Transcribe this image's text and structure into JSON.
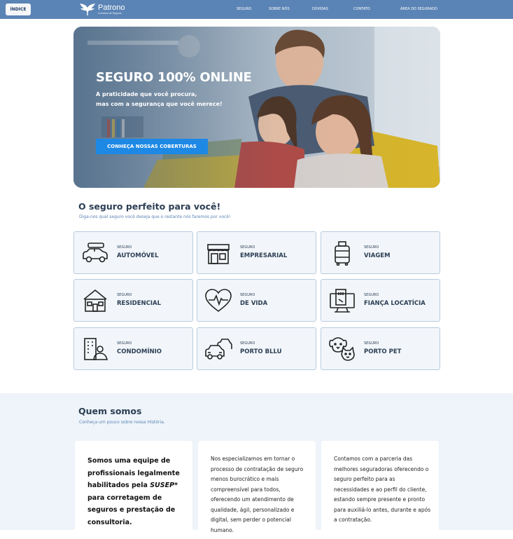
{
  "header": {
    "index_label": "ÍNDICE",
    "logo_name": "Patrono",
    "logo_tagline": "Corretora de Seguros",
    "nav": [
      "SEGURO",
      "SOBRE NÓS",
      "DÚVIDAS",
      "CONTATO",
      "ÁREA DO SEGURADO"
    ]
  },
  "hero": {
    "title": "SEGURO 100% ONLINE",
    "subtitle_line1": "A praticidade que você procura,",
    "subtitle_line2": "mas com a segurança que você merece!",
    "cta": "CONHEÇA NOSSAS COBERTURAS"
  },
  "products": {
    "title": "O seguro perfeito para você!",
    "subtitle": "Diga-nos qual seguro você deseja que o restante nós faremos por você!",
    "prefix": "SEGURO",
    "items": [
      {
        "name": "AUTOMÓVEL",
        "icon": "car-icon"
      },
      {
        "name": "EMPRESARIAL",
        "icon": "store-icon"
      },
      {
        "name": "VIAGEM",
        "icon": "luggage-icon"
      },
      {
        "name": "RESIDENCIAL",
        "icon": "house-icon"
      },
      {
        "name": "DE VIDA",
        "icon": "heart-pulse-icon"
      },
      {
        "name": "FIANÇA LOCATÍCIA",
        "icon": "rental-sign-icon"
      },
      {
        "name": "CONDOMÍNIO",
        "icon": "building-person-icon"
      },
      {
        "name": "PORTO BLLU",
        "icon": "cars-icon"
      },
      {
        "name": "PORTO PET",
        "icon": "pets-icon"
      }
    ]
  },
  "about": {
    "title": "Quem somos",
    "subtitle": "Conheça um pouco sobre nossa História.",
    "card1_a": "Somos uma equipe de profissionais legalmente habilitados pela ",
    "card1_brand": "SUSEP",
    "card1_b": "* para corretagem de seguros e prestação de consultoria.",
    "card2": "Nos especializamos em tornar o processo de contratação de seguro menos burocrático e mais compreensível para todos, oferecendo um atendimento de qualidade, ágil, personalizado e digital, sem perder o potencial humano.",
    "card3": "Contamos com a parceria das melhores seguradoras oferecendo o seguro perfeito para as necessidades e ao perfil do cliente, estando sempre presente e pronto para auxiliá-lo antes, durante e após a contratação."
  },
  "colors": {
    "header_bg": "#5b84b6",
    "cta_bg": "#1e88e5",
    "card_bg": "#f2f6fa",
    "card_border": "#b8cbe0",
    "section_bg": "#eef4f9",
    "title_text": "#2c3e55"
  }
}
